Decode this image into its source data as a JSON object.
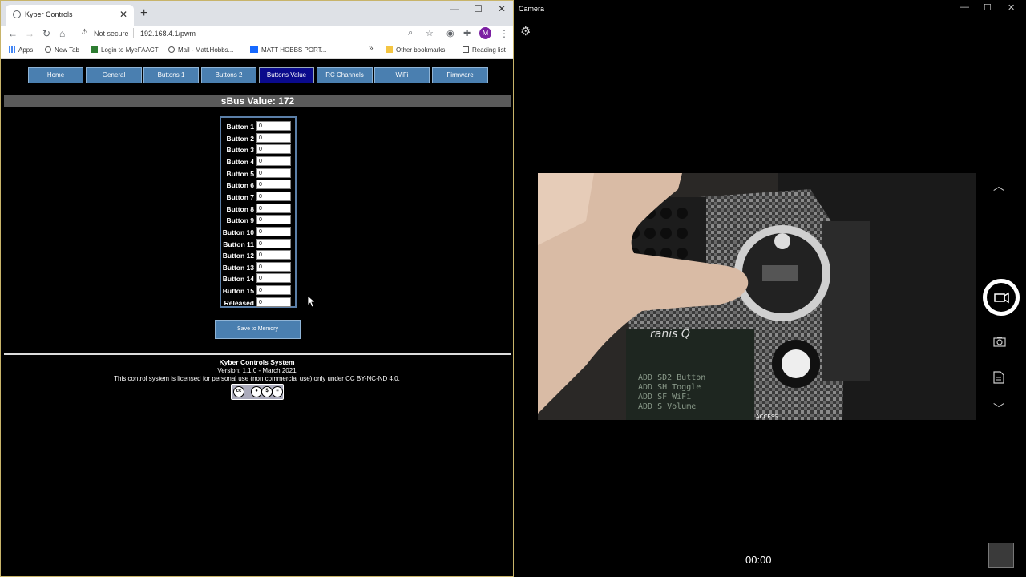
{
  "browser": {
    "tab_title": "Kyber Controls",
    "security_label": "Not secure",
    "url": "192.168.4.1/pwm",
    "profile_initial": "M",
    "bookmarks": [
      "Apps",
      "New Tab",
      "Login to MyeFAACT",
      "Mail - Matt.Hobbs...",
      "MATT HOBBS PORT..."
    ],
    "other_bookmarks": "Other bookmarks",
    "reading_list": "Reading list",
    "overflow": "»"
  },
  "nav": [
    "Home",
    "General",
    "Buttons 1",
    "Buttons 2",
    "Buttons Value",
    "RC Channels",
    "WiFi",
    "Firmware"
  ],
  "nav_active": "Buttons Value",
  "sbus_title": "sBus Value: 172",
  "buttons": [
    {
      "label": "Button 1",
      "value": "0"
    },
    {
      "label": "Button 2",
      "value": "0"
    },
    {
      "label": "Button 3",
      "value": "0"
    },
    {
      "label": "Button 4",
      "value": "0"
    },
    {
      "label": "Button 5",
      "value": "0"
    },
    {
      "label": "Button 6",
      "value": "0"
    },
    {
      "label": "Button 7",
      "value": "0"
    },
    {
      "label": "Button 8",
      "value": "0"
    },
    {
      "label": "Button 9",
      "value": "0"
    },
    {
      "label": "Button 10",
      "value": "0"
    },
    {
      "label": "Button 11",
      "value": "0"
    },
    {
      "label": "Button 12",
      "value": "0"
    },
    {
      "label": "Button 13",
      "value": "0"
    },
    {
      "label": "Button 14",
      "value": "0"
    },
    {
      "label": "Button 15",
      "value": "0"
    },
    {
      "label": "Released",
      "value": "0"
    }
  ],
  "save_label": "Save to Memory",
  "footer": {
    "title": "Kyber Controls System",
    "version": "Version: 1.1.0 - March 2021",
    "license": "This control system is licensed for personal use (non commercial use) only under CC BY-NC-ND 4.0.",
    "cc_badge_text": "BY NC ND"
  },
  "camera": {
    "title": "Camera",
    "timer": "00:00",
    "lcd_text": "ADD SD2 Button\nADD SH Toggle\nADD SF WiFi\nADD S Volume",
    "brand_text": "ranis Q",
    "access_text": "ACCESS"
  },
  "colors": {
    "nav_bg": "#4a7fb0",
    "nav_active_bg": "#0a0a8c",
    "sbus_bar_bg": "#5a5a5a",
    "table_border": "#5b7fa8"
  }
}
